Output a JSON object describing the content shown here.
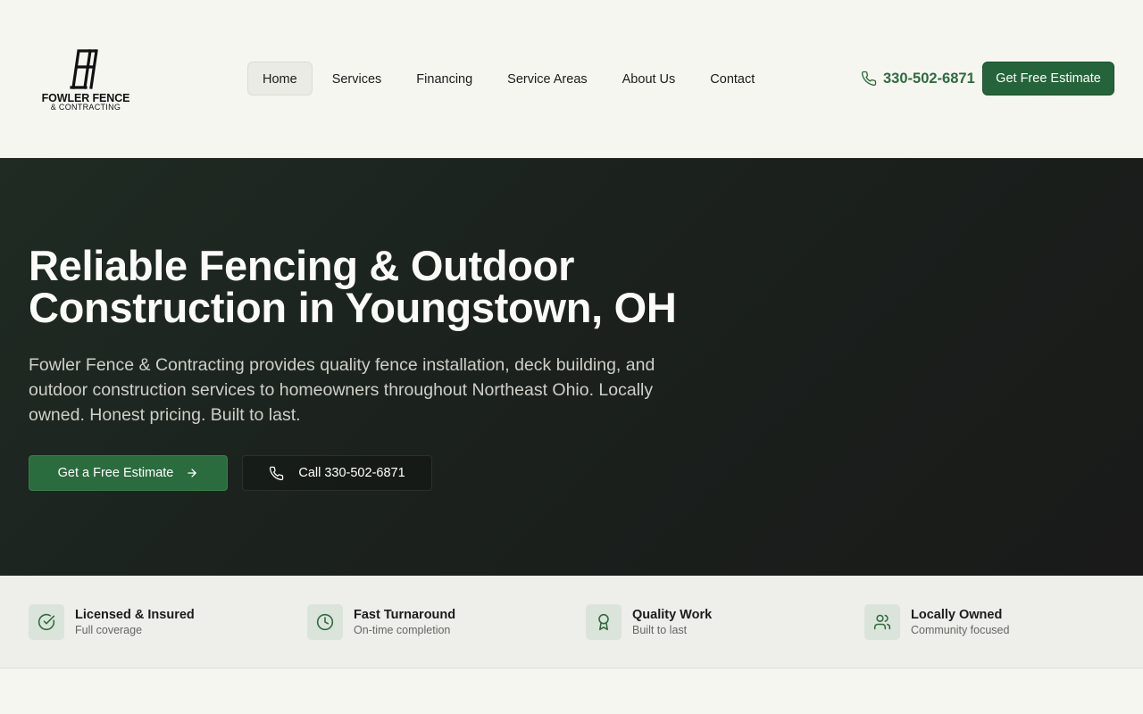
{
  "brand": {
    "name": "FOWLER FENCE",
    "sub": "& CONTRACTING"
  },
  "nav": {
    "items": [
      "Home",
      "Services",
      "Financing",
      "Service Areas",
      "About Us",
      "Contact"
    ],
    "active": "Home"
  },
  "header": {
    "phone": "330-502-6871",
    "estimate_button": "Get Free Estimate"
  },
  "hero": {
    "title_line1": "Reliable Fencing & Outdoor",
    "title_line2": "Construction in Youngstown, OH",
    "description": "Fowler Fence & Contracting provides quality fence installation, deck building, and outdoor construction services to homeowners throughout Northeast Ohio. Locally owned. Honest pricing. Built to last.",
    "primary_button": "Get a Free Estimate",
    "call_button": "Call 330-502-6871"
  },
  "features": [
    {
      "title": "Licensed & Insured",
      "sub": "Full coverage",
      "icon": "check-circle-icon"
    },
    {
      "title": "Fast Turnaround",
      "sub": "On-time completion",
      "icon": "clock-icon"
    },
    {
      "title": "Quality Work",
      "sub": "Built to last",
      "icon": "award-icon"
    },
    {
      "title": "Locally Owned",
      "sub": "Community focused",
      "icon": "users-icon"
    }
  ],
  "colors": {
    "accent": "#25643a",
    "accent_text": "#2f6b3f",
    "hero_bg": "#1b211d",
    "page_bg": "#f6f6f1",
    "feature_icon_bg": "#dbe4da"
  }
}
